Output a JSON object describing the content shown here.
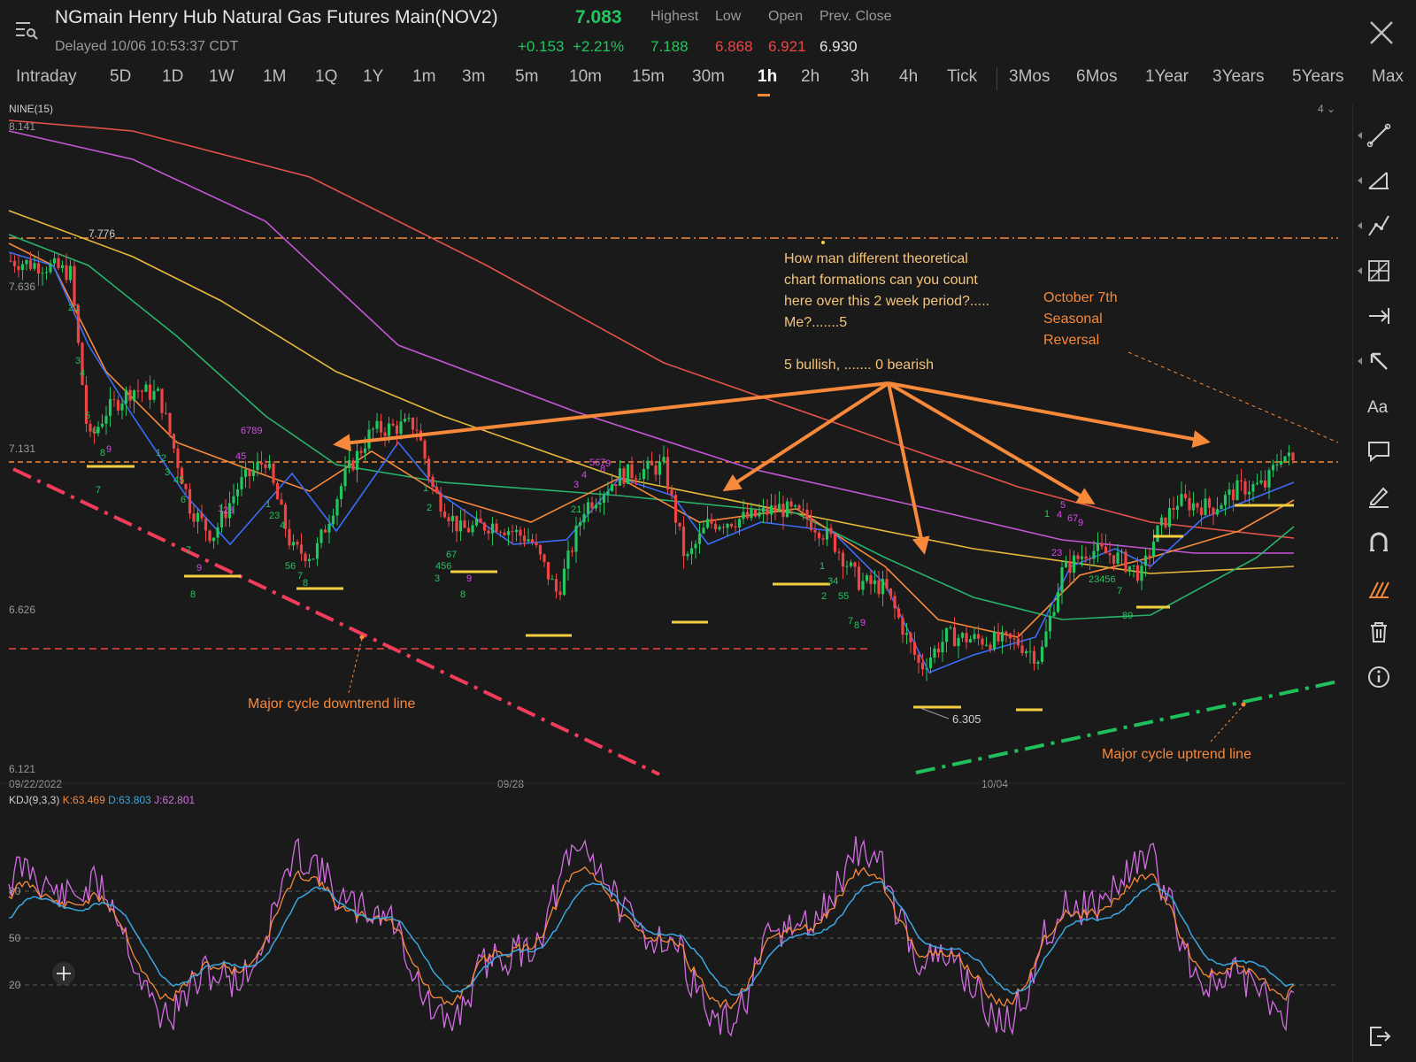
{
  "header": {
    "title": "NGmain Henry Hub Natural Gas Futures Main(NOV2)",
    "delayed": "Delayed 10/06 10:53:37 CDT",
    "price": "7.083",
    "change": "+0.153",
    "change_pct": "+2.21%",
    "labels": {
      "highest": "Highest",
      "low": "Low",
      "open": "Open",
      "prev_close": "Prev. Close"
    },
    "values": {
      "highest": "7.188",
      "low": "6.868",
      "open": "6.921",
      "prev_close": "6.930"
    }
  },
  "tabs": [
    "Intraday",
    "5D",
    "1D",
    "1W",
    "1M",
    "1Q",
    "1Y",
    "1m",
    "3m",
    "5m",
    "10m",
    "15m",
    "30m",
    "1h",
    "2h",
    "3h",
    "4h",
    "Tick",
    "3Mos",
    "6Mos",
    "1Year",
    "3Years",
    "5Years",
    "Max"
  ],
  "active_tab": "1h",
  "indicator": {
    "label": "NINE(15)",
    "zoom": "4"
  },
  "kdj": {
    "label": "KDJ(9,3,3)",
    "k": "K:63.469",
    "d": "D:63.803",
    "j": "J:62.801"
  },
  "colors": {
    "up": "#22c55e",
    "down": "#ef4444",
    "accent": "#f7893a",
    "k": "#f7893a",
    "d": "#3ba7e0",
    "j": "#d16ee0"
  },
  "chart_data": {
    "type": "candlestick",
    "symbol": "NGmain",
    "y_ticks": [
      "8.141",
      "7.636",
      "7.131",
      "6.626",
      "6.121"
    ],
    "x_ticks": [
      "09/22/2022",
      "09/28",
      "10/04"
    ],
    "price_labels": [
      "7.776",
      "6.305"
    ],
    "annotations": {
      "main_question": [
        "How man different theoretical",
        "chart formations can you count",
        "here over this 2 week period?.....",
        "Me?.......5",
        "",
        "5 bullish, .......  0 bearish"
      ],
      "seasonal": [
        "October 7th",
        "Seasonal",
        "Reversal"
      ],
      "downtrend": "Major cycle downtrend line",
      "uptrend": "Major cycle uptrend line"
    },
    "kdj_ticks": [
      "80",
      "50",
      "20"
    ]
  },
  "icons": [
    "trendline-icon",
    "angle-icon",
    "fib-icon",
    "grid-icon",
    "measure-icon",
    "arrow-icon",
    "text-icon",
    "comment-icon",
    "pen-icon",
    "magnet-icon",
    "indicators-icon",
    "trash-icon",
    "info-icon",
    "exit-icon"
  ]
}
